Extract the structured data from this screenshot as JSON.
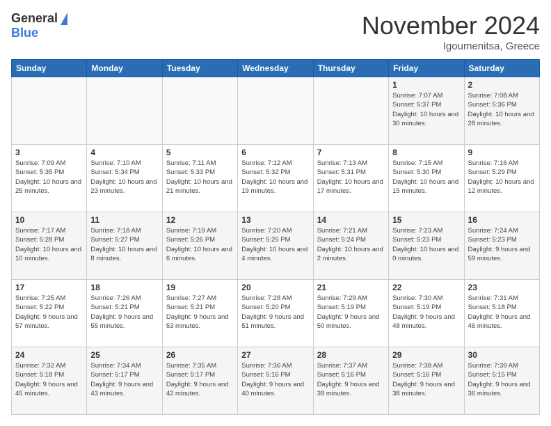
{
  "header": {
    "logo_general": "General",
    "logo_blue": "Blue",
    "month_title": "November 2024",
    "location": "Igoumenitsa, Greece"
  },
  "days_of_week": [
    "Sunday",
    "Monday",
    "Tuesday",
    "Wednesday",
    "Thursday",
    "Friday",
    "Saturday"
  ],
  "weeks": [
    [
      {
        "day": "",
        "info": ""
      },
      {
        "day": "",
        "info": ""
      },
      {
        "day": "",
        "info": ""
      },
      {
        "day": "",
        "info": ""
      },
      {
        "day": "",
        "info": ""
      },
      {
        "day": "1",
        "info": "Sunrise: 7:07 AM\nSunset: 5:37 PM\nDaylight: 10 hours and 30 minutes."
      },
      {
        "day": "2",
        "info": "Sunrise: 7:08 AM\nSunset: 5:36 PM\nDaylight: 10 hours and 28 minutes."
      }
    ],
    [
      {
        "day": "3",
        "info": "Sunrise: 7:09 AM\nSunset: 5:35 PM\nDaylight: 10 hours and 25 minutes."
      },
      {
        "day": "4",
        "info": "Sunrise: 7:10 AM\nSunset: 5:34 PM\nDaylight: 10 hours and 23 minutes."
      },
      {
        "day": "5",
        "info": "Sunrise: 7:11 AM\nSunset: 5:33 PM\nDaylight: 10 hours and 21 minutes."
      },
      {
        "day": "6",
        "info": "Sunrise: 7:12 AM\nSunset: 5:32 PM\nDaylight: 10 hours and 19 minutes."
      },
      {
        "day": "7",
        "info": "Sunrise: 7:13 AM\nSunset: 5:31 PM\nDaylight: 10 hours and 17 minutes."
      },
      {
        "day": "8",
        "info": "Sunrise: 7:15 AM\nSunset: 5:30 PM\nDaylight: 10 hours and 15 minutes."
      },
      {
        "day": "9",
        "info": "Sunrise: 7:16 AM\nSunset: 5:29 PM\nDaylight: 10 hours and 12 minutes."
      }
    ],
    [
      {
        "day": "10",
        "info": "Sunrise: 7:17 AM\nSunset: 5:28 PM\nDaylight: 10 hours and 10 minutes."
      },
      {
        "day": "11",
        "info": "Sunrise: 7:18 AM\nSunset: 5:27 PM\nDaylight: 10 hours and 8 minutes."
      },
      {
        "day": "12",
        "info": "Sunrise: 7:19 AM\nSunset: 5:26 PM\nDaylight: 10 hours and 6 minutes."
      },
      {
        "day": "13",
        "info": "Sunrise: 7:20 AM\nSunset: 5:25 PM\nDaylight: 10 hours and 4 minutes."
      },
      {
        "day": "14",
        "info": "Sunrise: 7:21 AM\nSunset: 5:24 PM\nDaylight: 10 hours and 2 minutes."
      },
      {
        "day": "15",
        "info": "Sunrise: 7:23 AM\nSunset: 5:23 PM\nDaylight: 10 hours and 0 minutes."
      },
      {
        "day": "16",
        "info": "Sunrise: 7:24 AM\nSunset: 5:23 PM\nDaylight: 9 hours and 59 minutes."
      }
    ],
    [
      {
        "day": "17",
        "info": "Sunrise: 7:25 AM\nSunset: 5:22 PM\nDaylight: 9 hours and 57 minutes."
      },
      {
        "day": "18",
        "info": "Sunrise: 7:26 AM\nSunset: 5:21 PM\nDaylight: 9 hours and 55 minutes."
      },
      {
        "day": "19",
        "info": "Sunrise: 7:27 AM\nSunset: 5:21 PM\nDaylight: 9 hours and 53 minutes."
      },
      {
        "day": "20",
        "info": "Sunrise: 7:28 AM\nSunset: 5:20 PM\nDaylight: 9 hours and 51 minutes."
      },
      {
        "day": "21",
        "info": "Sunrise: 7:29 AM\nSunset: 5:19 PM\nDaylight: 9 hours and 50 minutes."
      },
      {
        "day": "22",
        "info": "Sunrise: 7:30 AM\nSunset: 5:19 PM\nDaylight: 9 hours and 48 minutes."
      },
      {
        "day": "23",
        "info": "Sunrise: 7:31 AM\nSunset: 5:18 PM\nDaylight: 9 hours and 46 minutes."
      }
    ],
    [
      {
        "day": "24",
        "info": "Sunrise: 7:32 AM\nSunset: 5:18 PM\nDaylight: 9 hours and 45 minutes."
      },
      {
        "day": "25",
        "info": "Sunrise: 7:34 AM\nSunset: 5:17 PM\nDaylight: 9 hours and 43 minutes."
      },
      {
        "day": "26",
        "info": "Sunrise: 7:35 AM\nSunset: 5:17 PM\nDaylight: 9 hours and 42 minutes."
      },
      {
        "day": "27",
        "info": "Sunrise: 7:36 AM\nSunset: 5:16 PM\nDaylight: 9 hours and 40 minutes."
      },
      {
        "day": "28",
        "info": "Sunrise: 7:37 AM\nSunset: 5:16 PM\nDaylight: 9 hours and 39 minutes."
      },
      {
        "day": "29",
        "info": "Sunrise: 7:38 AM\nSunset: 5:16 PM\nDaylight: 9 hours and 38 minutes."
      },
      {
        "day": "30",
        "info": "Sunrise: 7:39 AM\nSunset: 5:15 PM\nDaylight: 9 hours and 36 minutes."
      }
    ]
  ]
}
